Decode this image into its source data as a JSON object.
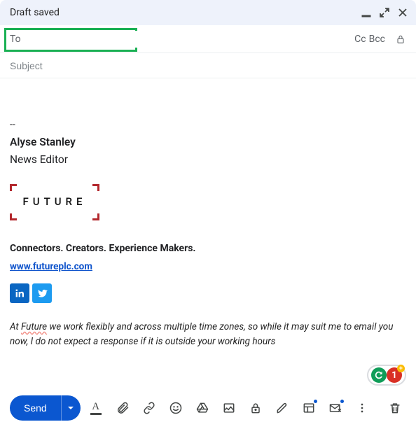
{
  "header": {
    "title": "Draft saved"
  },
  "to": {
    "label": "To",
    "value": "",
    "cc": "Cc",
    "bcc": "Bcc"
  },
  "subject": {
    "placeholder": "Subject",
    "value": ""
  },
  "sig": {
    "dashes": "--",
    "name": "Alyse Stanley",
    "role": "News Editor",
    "logo_text": "FUTURE",
    "tagline": "Connectors. Creators. Experience Makers.",
    "site": "www.futureplc.com",
    "fineprint_prefix": "At ",
    "fineprint_company": "Future",
    "fineprint_rest": " we work flexibly and across multiple time zones, so while it may suit me to email you now, I do not expect a response if it is outside your working hours"
  },
  "badges": {
    "red_count": "1"
  },
  "toolbar": {
    "send": "Send"
  }
}
